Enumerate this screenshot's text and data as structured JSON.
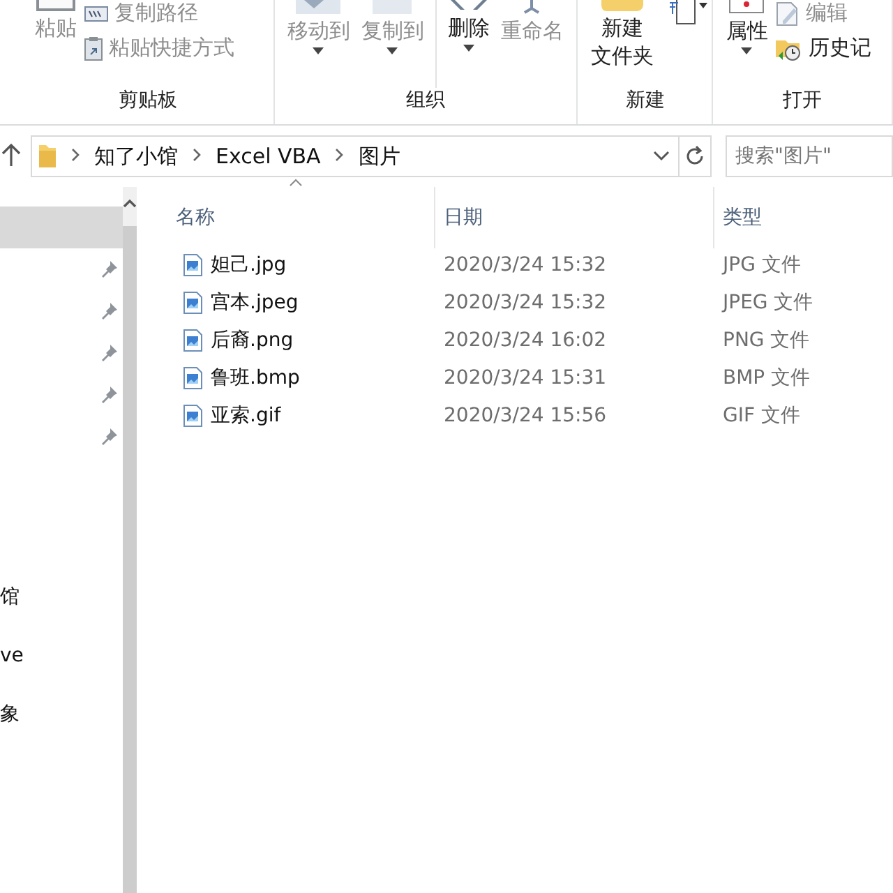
{
  "ribbon": {
    "groups": [
      {
        "label": "剪贴板",
        "items": [
          {
            "kind": "large",
            "label": "粘贴",
            "disabled": true,
            "dropdown": false
          },
          {
            "kind": "stack",
            "items": [
              {
                "label": "复制路径",
                "disabled": true
              },
              {
                "label": "粘贴快捷方式",
                "disabled": true
              }
            ]
          }
        ]
      },
      {
        "label": "组织",
        "items": [
          {
            "kind": "large",
            "label": "移动到",
            "disabled": true,
            "dropdown": true
          },
          {
            "kind": "large",
            "label": "复制到",
            "disabled": true,
            "dropdown": true
          },
          {
            "kind": "sep"
          },
          {
            "kind": "large",
            "label": "删除",
            "disabled": false,
            "dropdown": true
          },
          {
            "kind": "large",
            "label": "重命名",
            "disabled": true,
            "dropdown": false
          }
        ]
      },
      {
        "label": "新建",
        "items": [
          {
            "kind": "large",
            "label": "新建文件夹",
            "disabled": false,
            "dropdown": false
          },
          {
            "kind": "iconmenu"
          }
        ]
      },
      {
        "label": "打开",
        "items": [
          {
            "kind": "large",
            "label": "属性",
            "disabled": false,
            "dropdown": true
          },
          {
            "kind": "stack",
            "items": [
              {
                "label": "编辑",
                "disabled": true
              },
              {
                "label": "历史记",
                "disabled": false
              }
            ]
          }
        ]
      }
    ]
  },
  "address": {
    "path": [
      "知了小馆",
      "Excel VBA",
      "图片"
    ],
    "search_placeholder": "搜索\"图片\""
  },
  "nav": {
    "quick_access": [
      {
        "selected": true,
        "pinned": false
      },
      {
        "selected": false,
        "pinned": true
      },
      {
        "selected": false,
        "pinned": true
      },
      {
        "selected": false,
        "pinned": true
      },
      {
        "selected": false,
        "pinned": true
      },
      {
        "selected": false,
        "pinned": true
      }
    ],
    "places": [
      {
        "label": "馆",
        "selected": false
      },
      {
        "label": "ve",
        "selected": false
      },
      {
        "label": "象",
        "selected": false
      }
    ]
  },
  "table": {
    "columns": [
      "名称",
      "日期",
      "类型"
    ],
    "rows": [
      [
        "妲己.jpg",
        "2020/3/24 15:32",
        "JPG 文件"
      ],
      [
        "宫本.jpeg",
        "2020/3/24 15:32",
        "JPEG 文件"
      ],
      [
        "后裔.png",
        "2020/3/24 16:02",
        "PNG 文件"
      ],
      [
        "鲁班.bmp",
        "2020/3/24 15:31",
        "BMP 文件"
      ],
      [
        "亚索.gif",
        "2020/3/24 15:56",
        "GIF 文件"
      ]
    ]
  }
}
